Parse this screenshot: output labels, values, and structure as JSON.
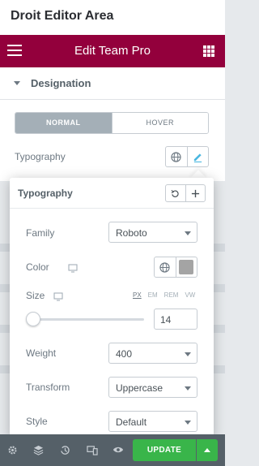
{
  "page_title": "Droit Editor Area",
  "header": {
    "title": "Edit Team Pro",
    "menu_icon": "hamburger-icon",
    "widgets_icon": "grid-icon"
  },
  "section": {
    "label": "Designation"
  },
  "tabs": [
    {
      "label": "NORMAL",
      "active": true
    },
    {
      "label": "HOVER",
      "active": false
    }
  ],
  "typography_row": {
    "label": "Typography"
  },
  "popover": {
    "title": "Typography",
    "fields": {
      "family": {
        "label": "Family",
        "value": "Roboto"
      },
      "color": {
        "label": "Color",
        "swatch": "#a4a4a4"
      },
      "size": {
        "label": "Size",
        "units": [
          "PX",
          "EM",
          "REM",
          "VW"
        ],
        "active_unit": "PX",
        "value": "14"
      },
      "weight": {
        "label": "Weight",
        "value": "400"
      },
      "transform": {
        "label": "Transform",
        "value": "Uppercase"
      },
      "style": {
        "label": "Style",
        "value": "Default"
      }
    }
  },
  "footer": {
    "update_label": "UPDATE"
  },
  "colors": {
    "header_bg": "#93003c",
    "update_bg": "#39b54a",
    "footer_bg": "#556068",
    "active_tab": "#a4afb7"
  }
}
